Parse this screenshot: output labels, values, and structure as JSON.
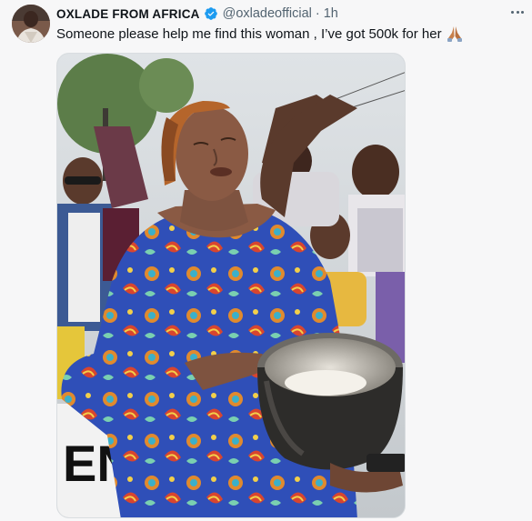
{
  "tweet": {
    "display_name": "OXLADE FROM AFRICA",
    "handle": "@oxladeofficial",
    "separator": "·",
    "time": "1h",
    "text": "Someone please help me find this woman , I’ve got 500k for her",
    "emoji_icon": "folded-hands-icon",
    "verified_icon": "verified-badge-icon",
    "more_icon": "more-options-icon",
    "colors": {
      "verified": "#1d9bf0",
      "secondary_text": "#536471",
      "primary_text": "#0f1419"
    }
  },
  "media": {
    "description_icon": "photo-image",
    "banner_text": "EN"
  }
}
